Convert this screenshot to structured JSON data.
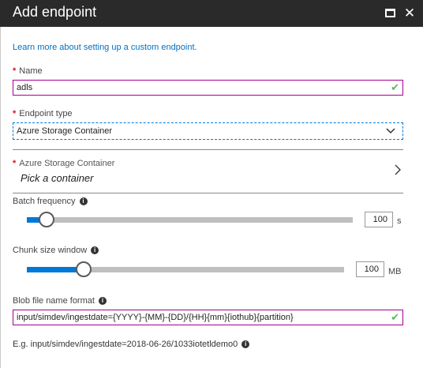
{
  "header": {
    "title": "Add endpoint",
    "maximize_icon": "maximize-icon",
    "close_icon": "close-icon"
  },
  "learn_more_link": "Learn more about setting up a custom endpoint.",
  "name_field": {
    "required_marker": "*",
    "label": "Name",
    "value": "adls"
  },
  "endpoint_type": {
    "required_marker": "*",
    "label": "Endpoint type",
    "selected": "Azure Storage Container"
  },
  "container_picker": {
    "required_marker": "*",
    "label": "Azure Storage Container",
    "value": "Pick a container"
  },
  "batch_frequency": {
    "label": "Batch frequency",
    "value": "100",
    "unit": "s",
    "slider_fraction": 0.06
  },
  "chunk_size": {
    "label": "Chunk size window",
    "value": "100",
    "unit": "MB",
    "slider_fraction": 0.18
  },
  "blob_format": {
    "label": "Blob file name format",
    "value": "input/simdev/ingestdate={YYYY}-{MM}-{DD}/{HH}{mm}{iothub}{partition}"
  },
  "example": "E.g. input/simdev/ingestdate=2018-06-26/1033iotetldemo0",
  "colors": {
    "accent": "#0078d7",
    "valid_border": "#a2008e",
    "required": "#e00b1c",
    "valid_check": "#5cb85c",
    "titlebar": "#2a2a2a"
  }
}
